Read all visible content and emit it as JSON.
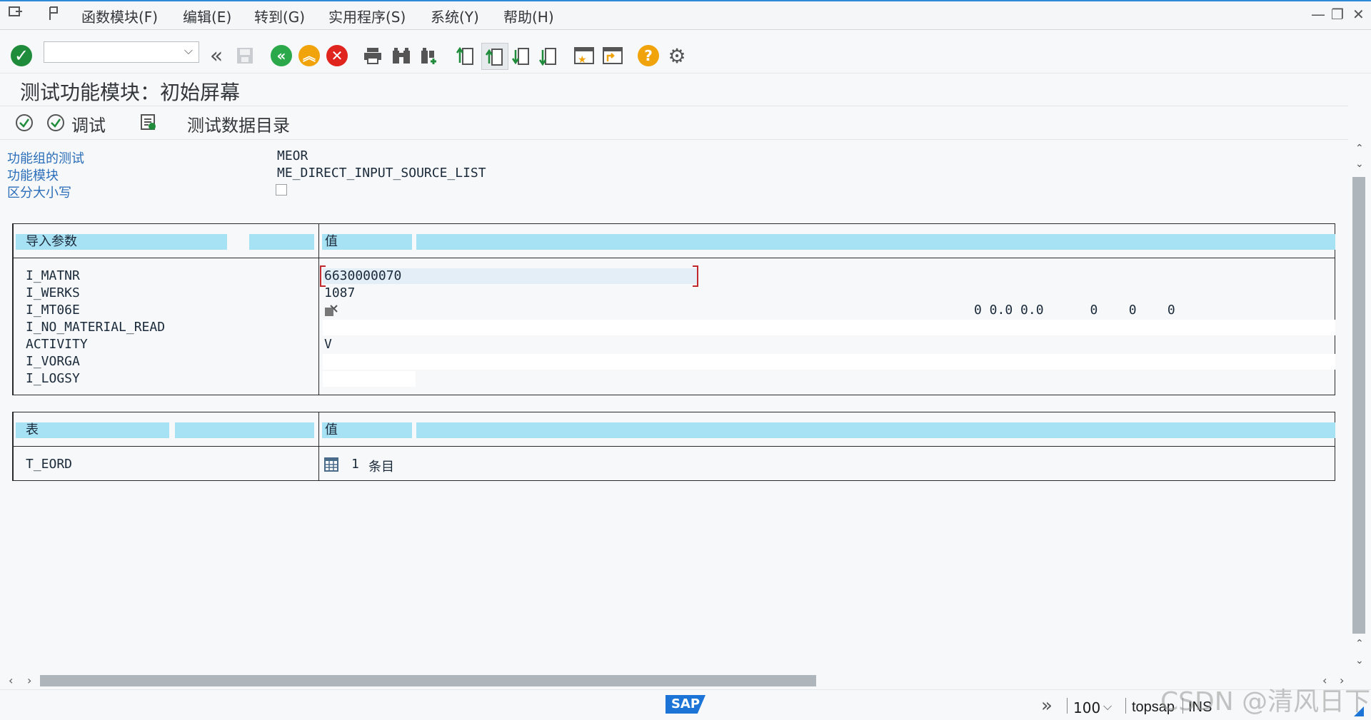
{
  "menu": {
    "items": [
      "函数模块(F)",
      "编辑(E)",
      "转到(G)",
      "实用程序(S)",
      "系统(Y)",
      "帮助(H)"
    ]
  },
  "window_controls": {
    "minimize": "—",
    "restore": "❐",
    "close": "✕"
  },
  "toolbar": {
    "command_value": "",
    "dropdown_glyph": "⌵"
  },
  "title": "测试功能模块：初始屏幕",
  "app_toolbar": {
    "debug_label": "调试",
    "test_data_dir_label": "测试数据目录"
  },
  "fields": {
    "group_label": "功能组的测试",
    "group_value": "MEOR",
    "module_label": "功能模块",
    "module_value": "ME_DIRECT_INPUT_SOURCE_LIST",
    "case_label": "区分大小写",
    "case_checked": false
  },
  "import_table": {
    "header_param": "导入参数",
    "header_value": "值",
    "rows": [
      {
        "name": "I_MATNR",
        "value": "6630000070"
      },
      {
        "name": "I_WERKS",
        "value": "1087"
      },
      {
        "name": "I_MT06E",
        "value": "",
        "extra": "0 0.0 0.0      0    0    0"
      },
      {
        "name": "I_NO_MATERIAL_READ",
        "value": ""
      },
      {
        "name": "ACTIVITY",
        "value": "V"
      },
      {
        "name": "I_VORGA",
        "value": ""
      },
      {
        "name": "I_LOGSY",
        "value": ""
      }
    ]
  },
  "tables_table": {
    "header_table": "表",
    "header_value": "值",
    "rows": [
      {
        "name": "T_EORD",
        "count": "1",
        "unit": "条目"
      }
    ]
  },
  "status": {
    "logo": "SAP",
    "chevron": "»",
    "client": "100",
    "client_glyph": "⌵",
    "server": "topsap",
    "mode": "INS"
  },
  "watermark": "CSDN @清风日下",
  "colors": {
    "accent_blue": "#2e8ad8",
    "header_cyan": "#a7e2f4",
    "label_blue": "#2a6db8",
    "ok_green": "#1e8c3a",
    "back_green": "#2aa84a",
    "exit_orange": "#f0a30a",
    "cancel_red": "#e0241e",
    "help_orange": "#f0a30a"
  }
}
